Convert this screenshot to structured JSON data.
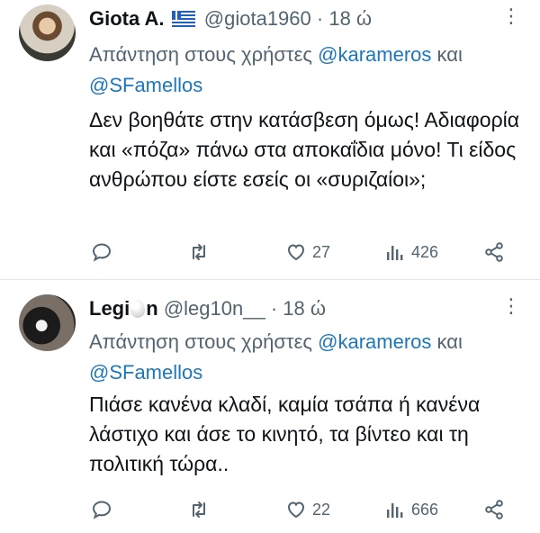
{
  "tweets": [
    {
      "name": "Giota A.",
      "handle": "@giota1960",
      "separator": "·",
      "time": "18 ώ",
      "reply_prefix": "Απάντηση στους χρήστες",
      "mention_1": "@karameros",
      "conjunction": "και",
      "mention_2": "@SFamellos",
      "text": "Δεν βοηθάτε στην κατάσβεση όμως! Αδιαφορία και «πόζα» πάνω στα αποκαΐδια μόνο! Τι είδος ανθρώπου είστε εσείς οι «συριζαίοι»;",
      "likes": "27",
      "views": "426"
    },
    {
      "name_part_1": "Legi",
      "name_part_2": "n",
      "handle": "@leg10n__",
      "separator": "·",
      "time": "18 ώ",
      "reply_prefix": "Απάντηση στους χρήστες",
      "mention_1": "@karameros",
      "conjunction": "και",
      "mention_2": "@SFamellos",
      "text": "Πιάσε κανένα κλαδί, καμία τσάπα ή κανένα λάστιχο και άσε το κινητό, τα βίντεο και τη πολιτική τώρα..",
      "likes": "22",
      "views": "666"
    }
  ],
  "more_glyph": "⋮",
  "icons": [
    "reply-icon",
    "retweet-icon",
    "heart-icon",
    "views-icon",
    "share-icon",
    "greek-flag-icon",
    "egg-emoji-icon",
    "more-icon"
  ],
  "colors": {
    "text": "#0f1419",
    "secondary": "#536471",
    "mention": "#1d77bd",
    "divider": "#e1e6ea"
  }
}
